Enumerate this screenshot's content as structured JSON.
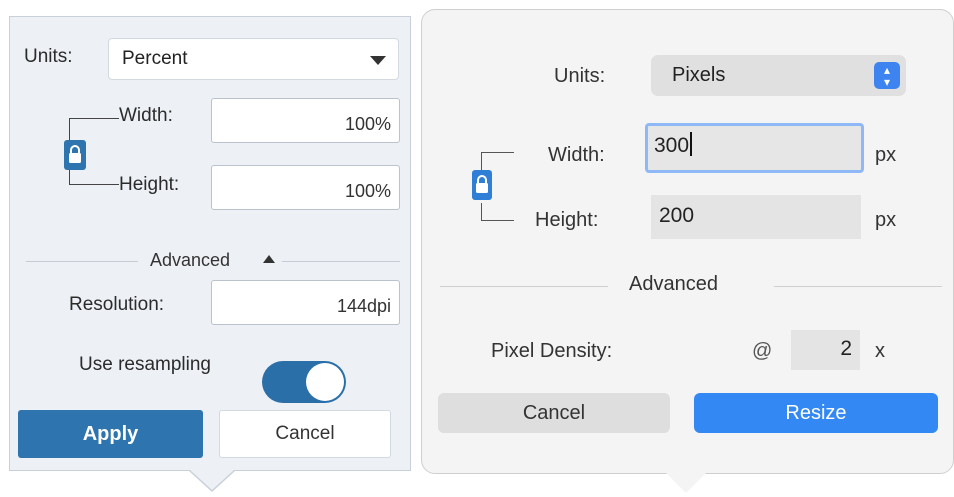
{
  "left_panel": {
    "units_label": "Units:",
    "units_value": "Percent",
    "width_label": "Width:",
    "width_value": "100%",
    "height_label": "Height:",
    "height_value": "100%",
    "advanced_label": "Advanced",
    "resolution_label": "Resolution:",
    "resolution_value": "144dpi",
    "resampling_label": "Use resampling",
    "resampling_on": true,
    "apply_label": "Apply",
    "cancel_label": "Cancel"
  },
  "right_panel": {
    "units_label": "Units:",
    "units_value": "Pixels",
    "width_label": "Width:",
    "width_value": "300",
    "width_unit": "px",
    "height_label": "Height:",
    "height_value": "200",
    "height_unit": "px",
    "advanced_label": "Advanced",
    "density_label": "Pixel Density:",
    "density_at": "@",
    "density_value": "2",
    "density_suffix": "x",
    "cancel_label": "Cancel",
    "resize_label": "Resize"
  },
  "colors": {
    "left_accent": "#2e74ae",
    "right_accent": "#3388f4",
    "focus_ring": "#8fb8f6"
  },
  "icons": {
    "left_lock": "lock-icon",
    "left_dropdown": "chevron-down-icon",
    "right_lock": "lock-icon",
    "right_stepper": "updown-stepper-icon"
  }
}
